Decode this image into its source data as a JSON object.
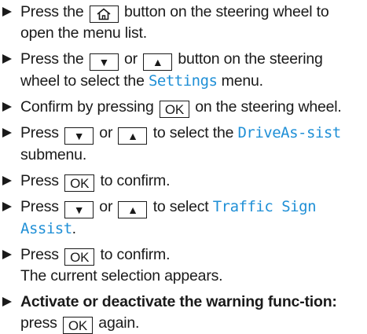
{
  "keys": {
    "home_icon": "home-icon",
    "down_arrow": "▼",
    "up_arrow": "▲",
    "ok": "OK"
  },
  "steps": [
    {
      "t1": "Press the",
      "t2": "button on the steering wheel to open the menu list."
    },
    {
      "t1": "Press the",
      "t_or": "or",
      "t2": "button on the steering wheel to select the",
      "menu": "Settings",
      "t3": "menu."
    },
    {
      "t1": "Confirm by pressing",
      "t2": "on the steering wheel."
    },
    {
      "t1": "Press",
      "t_or": "or",
      "t2": "to select the",
      "menu": "DriveAs-sist",
      "t3": "submenu."
    },
    {
      "t1": "Press",
      "t2": "to confirm."
    },
    {
      "t1": "Press",
      "t_or": "or",
      "t2": "to select",
      "menu": "Traffic Sign Assist",
      "t3": "."
    },
    {
      "t1": "Press",
      "t2": "to confirm.",
      "note": "The current selection appears."
    },
    {
      "bold": "Activate or deactivate the warning func-tion:",
      "t1": "press",
      "t2": "again."
    }
  ],
  "colors": {
    "menu_text": "#1f8fd6",
    "text": "#1a1a1a"
  }
}
